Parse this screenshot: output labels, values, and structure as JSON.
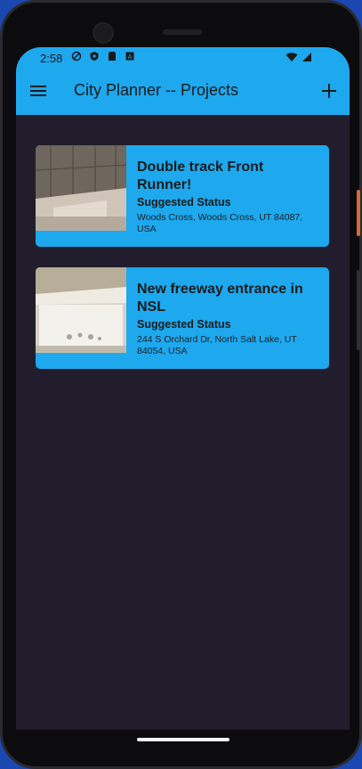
{
  "status_bar": {
    "time": "2:58",
    "left_icons": [
      "vpn-icon",
      "shield-icon",
      "sim-card-icon",
      "autofill-icon"
    ],
    "right_icons": [
      "wifi-icon",
      "cell-signal-icon"
    ]
  },
  "app_bar": {
    "title": "City Planner -- Projects",
    "menu_icon": "hamburger-menu-icon",
    "add_icon": "plus-icon",
    "color": "#1ea8ee"
  },
  "projects": [
    {
      "title": "Double track Front Runner!",
      "status": "Suggested Status",
      "address": "Woods Cross, Woods Cross, UT 84087, USA",
      "thumbnail": "acoustic-panels-photo"
    },
    {
      "title": "New freeway entrance in NSL",
      "status": "Suggested Status",
      "address": "244 S Orchard Dr, North Salt Lake, UT 84054, USA",
      "thumbnail": "white-shelf-photo"
    }
  ],
  "theme": {
    "background": "#221d2c",
    "card": "#1ea8ee"
  }
}
